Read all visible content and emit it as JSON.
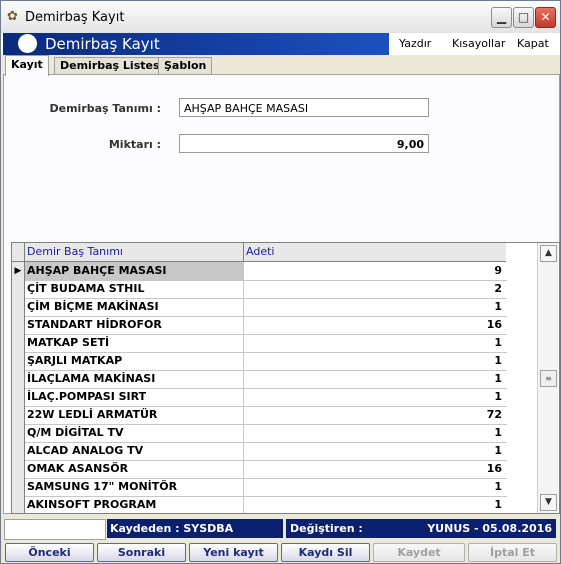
{
  "window": {
    "title": "Demirbaş Kayıt"
  },
  "header": {
    "title": "Demirbaş Kayıt",
    "menu": [
      "Yazdır",
      "Kısayollar",
      "Kapat"
    ]
  },
  "tabs": [
    {
      "label": "Kayıt",
      "active": true
    },
    {
      "label": "Demirbaş Listesi",
      "active": false
    },
    {
      "label": "Şablon",
      "active": false
    }
  ],
  "form": {
    "name_label": "Demirbaş Tanımı :",
    "name_value": "AHŞAP BAHÇE MASASI",
    "qty_label": "Miktarı :",
    "qty_value": "9,00"
  },
  "grid": {
    "columns": [
      "Demir Baş Tanımı",
      "Adeti"
    ],
    "rows": [
      {
        "name": "AHŞAP BAHÇE MASASI",
        "qty": "9",
        "selected": true
      },
      {
        "name": "ÇİT BUDAMA STHIL",
        "qty": "2"
      },
      {
        "name": "ÇİM BİÇME MAKİNASI",
        "qty": "1"
      },
      {
        "name": "STANDART HİDROFOR",
        "qty": "16"
      },
      {
        "name": "MATKAP SETİ",
        "qty": "1"
      },
      {
        "name": "ŞARJLI MATKAP",
        "qty": "1"
      },
      {
        "name": "İLAÇLAMA MAKİNASI",
        "qty": "1"
      },
      {
        "name": "İLAÇ.POMPASI SIRT",
        "qty": "1"
      },
      {
        "name": "22W LEDLİ ARMATÜR",
        "qty": "72"
      },
      {
        "name": "Q/M DİGİTAL TV",
        "qty": "1"
      },
      {
        "name": "ALCAD ANALOG TV",
        "qty": "1"
      },
      {
        "name": "OMAK ASANSÖR",
        "qty": "16"
      },
      {
        "name": "SAMSUNG 17\" MONİTÖR",
        "qty": "1"
      },
      {
        "name": "AKINSOFT PROGRAM",
        "qty": "1"
      }
    ]
  },
  "status": {
    "kaydeden": "Kaydeden :  SYSDBA",
    "degistiren_label": "Değiştiren :",
    "degistiren_value": "YUNUS  -  05.08.2016"
  },
  "buttons": {
    "prev": "Önceki",
    "next": "Sonraki",
    "new": "Yeni kayıt",
    "delete": "Kaydı Sil",
    "save": "Kaydet",
    "cancel": "İptal Et"
  },
  "colors": {
    "header_blue": "#0a2a7a",
    "status_navy": "#0a1f6e",
    "button_text": "#1c2c7c"
  }
}
